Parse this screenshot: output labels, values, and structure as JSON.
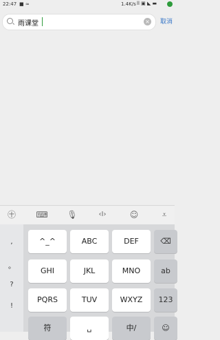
{
  "status_bar": {
    "time": "22:47",
    "left_icons": "■ ≈",
    "speed": "1.4K/s",
    "right_icons": "ll ▣ ◣ ▬"
  },
  "search": {
    "value": "雨课堂",
    "cancel_label": "取消",
    "clear_symbol": "×"
  },
  "toolbar": {
    "items": [
      {
        "name": "emoji-keyboard-icon",
        "glyph": "㊉"
      },
      {
        "name": "keyboard-icon",
        "glyph": "⌨"
      },
      {
        "name": "microphone-icon",
        "glyph": "🎙"
      },
      {
        "name": "cursor-move-icon",
        "glyph": "‹I›"
      },
      {
        "name": "emoji-icon",
        "glyph": "☺"
      },
      {
        "name": "collapse-keyboard-icon",
        "glyph": "⩡"
      }
    ]
  },
  "keyboard": {
    "side_keys": [
      ",",
      "。",
      "?",
      "!"
    ],
    "rows": [
      [
        "^_^",
        "ABC",
        "DEF"
      ],
      [
        "GHI",
        "JKL",
        "MNO"
      ],
      [
        "PQRS",
        "TUV",
        "WXYZ"
      ]
    ],
    "func_keys": [
      "⌫",
      "ab",
      "123"
    ],
    "bottom_keys": [
      "符",
      "␣",
      "中/",
      "☺"
    ]
  }
}
